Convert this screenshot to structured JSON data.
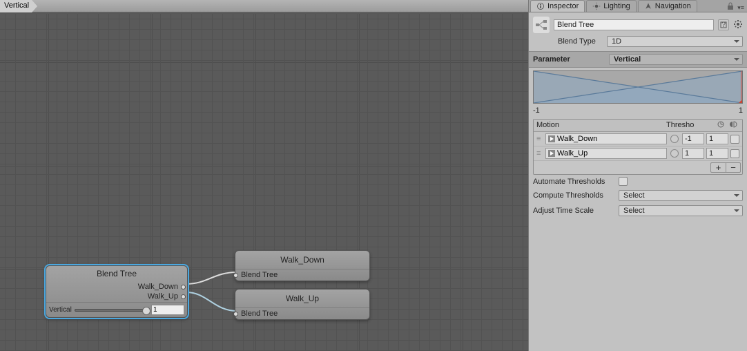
{
  "breadcrumb": "Vertical",
  "graph": {
    "blend_node": {
      "title": "Blend Tree",
      "ports": [
        "Walk_Down",
        "Walk_Up"
      ],
      "param": "Vertical",
      "value": "1"
    },
    "child_nodes": [
      {
        "title": "Walk_Down",
        "sub": "Blend Tree"
      },
      {
        "title": "Walk_Up",
        "sub": "Blend Tree"
      }
    ]
  },
  "inspector": {
    "tabs": {
      "inspector": "Inspector",
      "lighting": "Lighting",
      "navigation": "Navigation"
    },
    "name": "Blend Tree",
    "blend_type_label": "Blend Type",
    "blend_type_value": "1D",
    "parameter_label": "Parameter",
    "parameter_value": "Vertical",
    "range": {
      "min": "-1",
      "max": "1"
    },
    "motion_header": {
      "motion": "Motion",
      "thresh": "Thresho"
    },
    "motions": [
      {
        "name": "Walk_Down",
        "threshold": "-1",
        "speed": "1"
      },
      {
        "name": "Walk_Up",
        "threshold": "1",
        "speed": "1"
      }
    ],
    "automate": "Automate Thresholds",
    "compute": "Compute Thresholds",
    "adjust": "Adjust Time Scale",
    "select": "Select"
  },
  "chart_data": {
    "type": "line",
    "title": "",
    "xlabel": "",
    "ylabel": "",
    "xlim": [
      -1,
      1
    ],
    "ylim": [
      0,
      1
    ],
    "series": [
      {
        "name": "Walk_Down",
        "x": [
          -1,
          1
        ],
        "y": [
          1,
          0
        ]
      },
      {
        "name": "Walk_Up",
        "x": [
          -1,
          1
        ],
        "y": [
          0,
          1
        ]
      }
    ],
    "marker_x": 1
  }
}
